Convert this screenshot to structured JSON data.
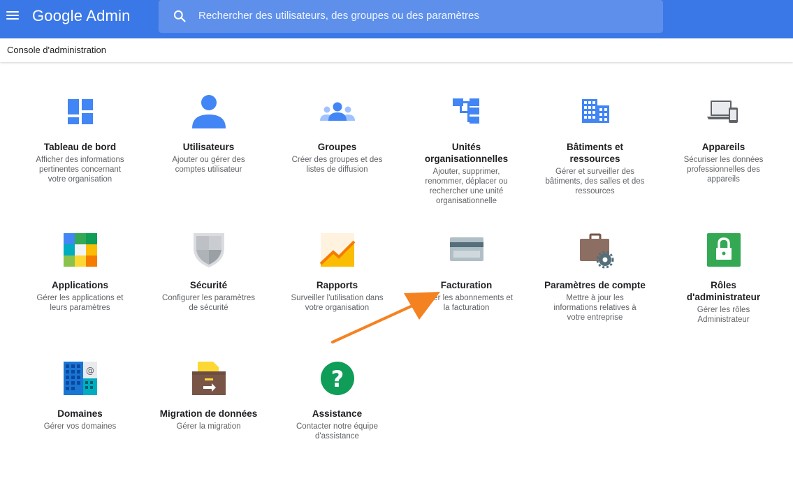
{
  "header": {
    "app_name": "Google Admin",
    "search_placeholder": "Rechercher des utilisateurs, des groupes ou des paramètres",
    "breadcrumb": "Console d'administration",
    "brand_color": "#3b78e7"
  },
  "tiles": [
    {
      "title": "Tableau de bord",
      "desc": "Afficher des informations pertinentes concernant votre organisation",
      "icon": "dashboard-icon"
    },
    {
      "title": "Utilisateurs",
      "desc": "Ajouter ou gérer des comptes utilisateur",
      "icon": "user-icon"
    },
    {
      "title": "Groupes",
      "desc": "Créer des groupes et des listes de diffusion",
      "icon": "groups-icon"
    },
    {
      "title": "Unités organisationnelles",
      "desc": "Ajouter, supprimer, renommer, déplacer ou rechercher une unité organisationnelle",
      "icon": "org-units-icon"
    },
    {
      "title": "Bâtiments et ressources",
      "desc": "Gérer et surveiller des bâtiments, des salles et des ressources",
      "icon": "building-icon"
    },
    {
      "title": "Appareils",
      "desc": "Sécuriser les données professionnelles des appareils",
      "icon": "devices-icon"
    },
    {
      "title": "Applications",
      "desc": "Gérer les applications et leurs paramètres",
      "icon": "apps-icon"
    },
    {
      "title": "Sécurité",
      "desc": "Configurer les paramètres de sécurité",
      "icon": "shield-icon"
    },
    {
      "title": "Rapports",
      "desc": "Surveiller l'utilisation dans votre organisation",
      "icon": "reports-icon"
    },
    {
      "title": "Facturation",
      "desc": "Gérer les abonnements et la facturation",
      "icon": "credit-card-icon"
    },
    {
      "title": "Paramètres de compte",
      "desc": "Mettre à jour les informations relatives à votre entreprise",
      "icon": "briefcase-gear-icon"
    },
    {
      "title": "Rôles d'administrateur",
      "desc": "Gérer les rôles Administrateur",
      "icon": "lock-icon"
    },
    {
      "title": "Domaines",
      "desc": "Gérer vos domaines",
      "icon": "domains-icon"
    },
    {
      "title": "Migration de données",
      "desc": "Gérer la migration",
      "icon": "migration-icon"
    },
    {
      "title": "Assistance",
      "desc": "Contacter notre équipe d'assistance",
      "icon": "help-icon"
    }
  ],
  "annotation": {
    "color": "#f58220",
    "icon": "arrow-icon"
  }
}
